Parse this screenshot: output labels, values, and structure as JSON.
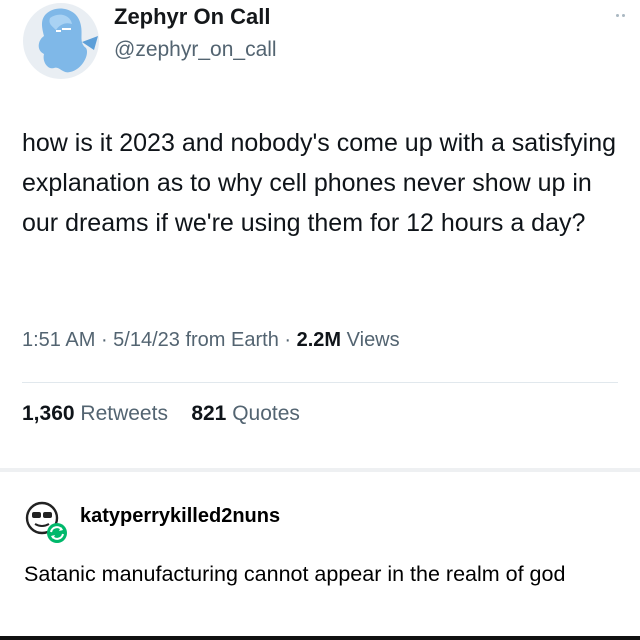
{
  "tweet": {
    "display_name": "Zephyr On Call",
    "handle": "@zephyr_on_call",
    "text": "how is it 2023 and nobody's come up with a satisfying explanation as to why cell phones never show up in our dreams if we're using them for 12 hours a day?",
    "time": "1:51 AM",
    "date": "5/14/23",
    "source": "from Earth",
    "views_count": "2.2M",
    "views_label": "Views",
    "retweets_count": "1,360",
    "retweets_label": "Retweets",
    "quotes_count": "821",
    "quotes_label": "Quotes",
    "avatar_icon": "ghost-avatar-icon",
    "more_icon": "more-options-icon"
  },
  "reply": {
    "username": "katyperrykilled2nuns",
    "text": "Satanic manufacturing cannot appear in the realm of god",
    "avatar_icon": "sunglasses-face-avatar-icon",
    "reblog_badge_icon": "reblog-icon"
  },
  "colors": {
    "avatar_blue": "#7fb8e8",
    "secondary_text": "#536471",
    "reblog_green": "#00b86b"
  }
}
